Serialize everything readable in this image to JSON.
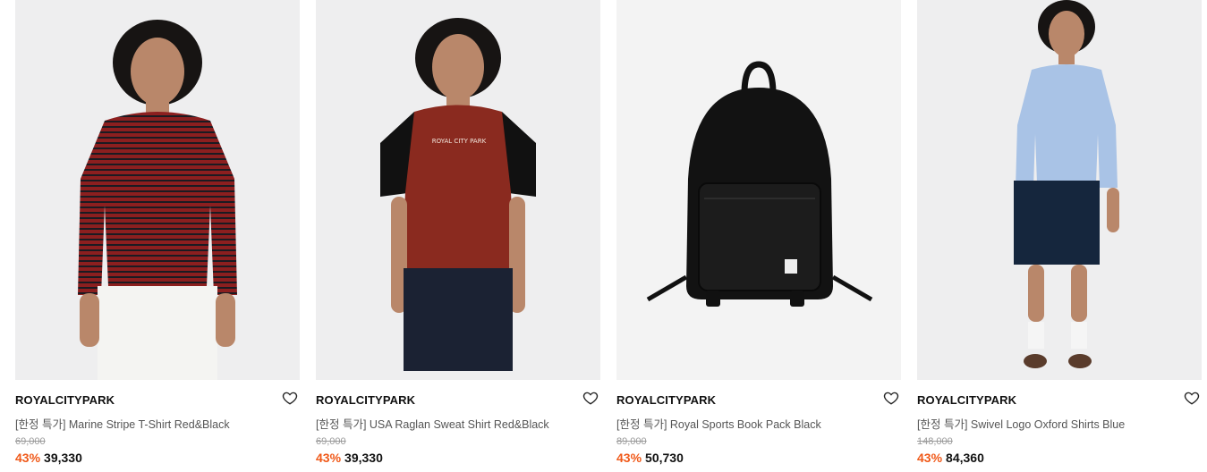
{
  "colors": {
    "discount": "#f05a1a",
    "text": "#111111",
    "muted": "#555555",
    "strike": "#9a9a9a"
  },
  "products": [
    {
      "brand": "ROYALCITYPARK",
      "name": "[한정 특가] Marine Stripe T-Shirt Red&Black",
      "original_price": "69,000",
      "discount": "43%",
      "price": "39,330",
      "icon": "heart-icon"
    },
    {
      "brand": "ROYALCITYPARK",
      "name": "[한정 특가] USA Raglan Sweat Shirt Red&Black",
      "original_price": "69,000",
      "discount": "43%",
      "price": "39,330",
      "icon": "heart-icon"
    },
    {
      "brand": "ROYALCITYPARK",
      "name": "[한정 특가] Royal Sports Book Pack Black",
      "original_price": "89,000",
      "discount": "43%",
      "price": "50,730",
      "icon": "heart-icon"
    },
    {
      "brand": "ROYALCITYPARK",
      "name": "[한정 특가] Swivel Logo Oxford Shirts Blue",
      "original_price": "148,000",
      "discount": "43%",
      "price": "84,360",
      "icon": "heart-icon"
    }
  ]
}
